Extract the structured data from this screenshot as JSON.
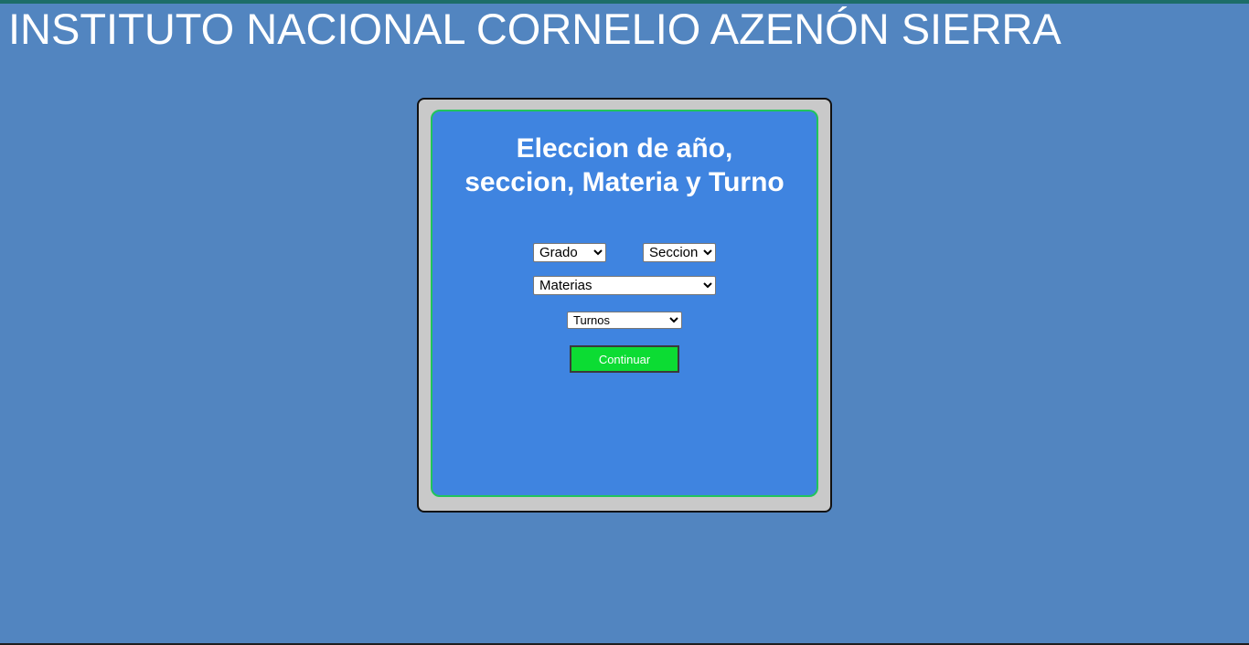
{
  "header": {
    "title": "INSTITUTO NACIONAL CORNELIO AZENÓN SIERRA"
  },
  "card": {
    "heading_line1": "Eleccion de año,",
    "heading_line2": "seccion, Materia y Turno"
  },
  "form": {
    "grado": {
      "selected": "Grado"
    },
    "seccion": {
      "selected": "Seccion"
    },
    "materias": {
      "selected": "Materias"
    },
    "turnos": {
      "selected": "Turnos"
    },
    "continue_label": "Continuar"
  },
  "colors": {
    "background": "#5285c0",
    "top_strip": "#1d6d68",
    "outer_card": "#c9c9c9",
    "inner_card": "#3f84e0",
    "inner_border": "#21c45c",
    "button": "#0cdc33"
  }
}
